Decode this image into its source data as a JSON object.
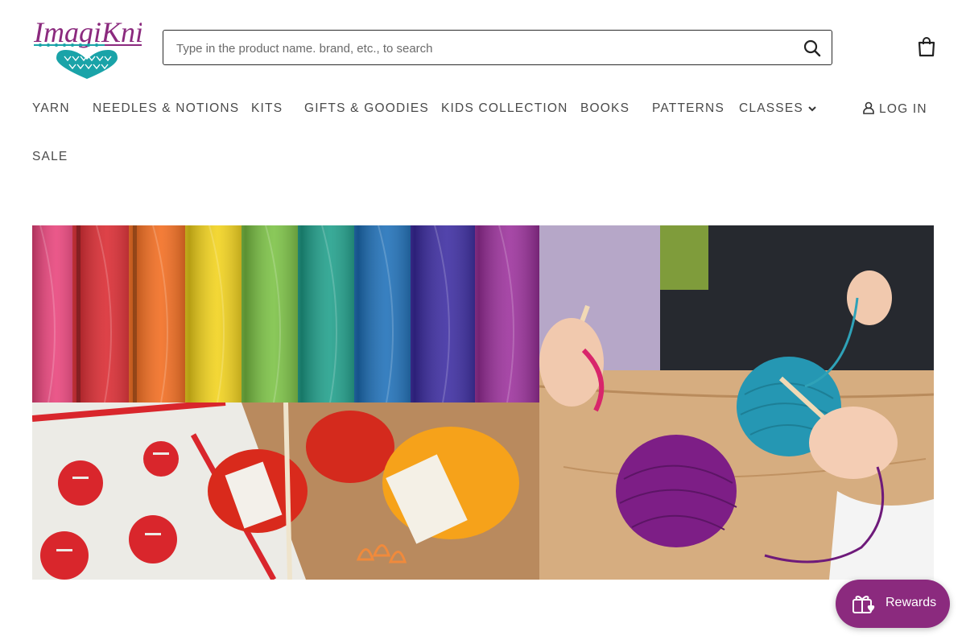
{
  "brand": {
    "logo_text": "ImagiKnit",
    "colors": {
      "primary": "#8b2a7e",
      "accent": "#1aa3a8"
    }
  },
  "search": {
    "placeholder": "Type in the product name. brand, etc., to search",
    "icon": "search-icon"
  },
  "cart": {
    "icon": "shopping-bag-icon"
  },
  "nav": {
    "items": [
      {
        "label": "YARN"
      },
      {
        "label": "NEEDLES & NOTIONS"
      },
      {
        "label": "KITS"
      },
      {
        "label": "GIFTS & GOODIES"
      },
      {
        "label": "KIDS COLLECTION"
      },
      {
        "label": "BOOKS"
      },
      {
        "label": "PATTERNS"
      },
      {
        "label": "CLASSES"
      }
    ],
    "login_label": "LOG IN",
    "sale_label": "SALE"
  },
  "hero": {
    "tiles": [
      {
        "name": "rainbow-yarn-skeins"
      },
      {
        "name": "notions-and-cotton-yarn"
      },
      {
        "name": "hands-knitting-with-yarn-balls"
      }
    ]
  },
  "rewards": {
    "label": "Rewards",
    "icon": "gift-heart-icon"
  }
}
